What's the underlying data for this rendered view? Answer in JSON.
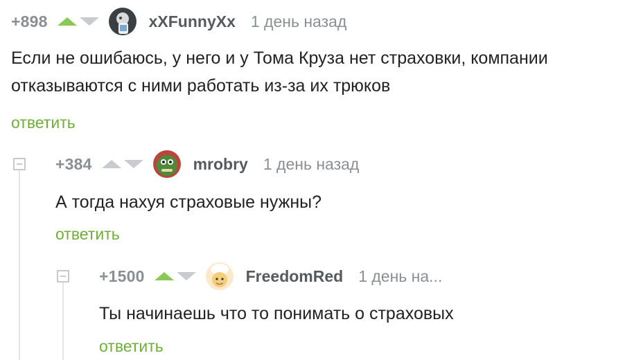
{
  "comments": [
    {
      "rating": "+898",
      "username": "xXFunnyXx",
      "date": "1 день назад",
      "text": "Если не ошибаюсь, у него и у Тома Круза нет страховки, компании отказываются с ними работать из-за их трюков",
      "reply_label": "ответить",
      "upvoted": true,
      "avatar_icon": "phone-guy-avatar"
    },
    {
      "rating": "+384",
      "username": "mrobry",
      "date": "1 день назад",
      "text": "А тогда нахуя страховые нужны?",
      "reply_label": "ответить",
      "upvoted": false,
      "avatar_icon": "dinosaur-avatar"
    },
    {
      "rating": "+1500",
      "username": "FreedomRed",
      "date": "1 день на...",
      "text": "Ты начинаешь что то понимать о страховых",
      "reply_label": "ответить",
      "upvoted": true,
      "avatar_icon": "chef-avatar"
    }
  ],
  "colors": {
    "accent_green": "#8ac858",
    "reply_green": "#6fae39",
    "muted_grey": "#8a8f93"
  }
}
